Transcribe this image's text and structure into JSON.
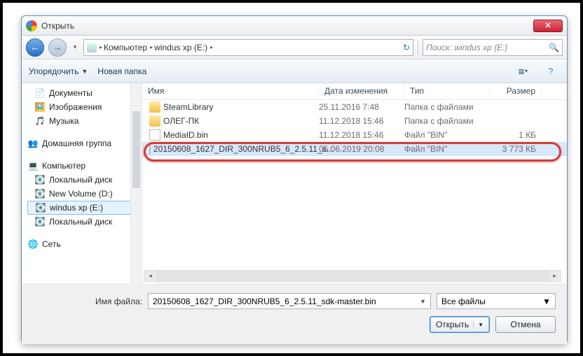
{
  "window": {
    "title": "Открыть",
    "close": "✕"
  },
  "nav": {
    "breadcrumb": [
      "Компьютер",
      "windus xp (E:)"
    ],
    "search_placeholder": "Поиск: windus xp (E:)"
  },
  "toolbar": {
    "organize": "Упорядочить",
    "new_folder": "Новая папка"
  },
  "tree": {
    "group1": [
      {
        "label": "Документы",
        "icon": "📄"
      },
      {
        "label": "Изображения",
        "icon": "🖼️"
      },
      {
        "label": "Музыка",
        "icon": "🎵"
      }
    ],
    "group2_head": "Домашняя группа",
    "group3_head": "Компьютер",
    "group3": [
      {
        "label": "Локальный диск"
      },
      {
        "label": "New Volume (D:)"
      },
      {
        "label": "windus xp (E:)"
      },
      {
        "label": "Локальный диск"
      }
    ],
    "group4_head": "Сеть"
  },
  "columns": {
    "name": "Имя",
    "date": "Дата изменения",
    "type": "Тип",
    "size": "Размер"
  },
  "rows": [
    {
      "name": "SteamLibrary",
      "date": "25.11.2016 7:48",
      "type": "Папка с файлами",
      "size": "",
      "kind": "folder"
    },
    {
      "name": "ОЛЕГ-ПК",
      "date": "11.12.2018 15:46",
      "type": "Папка с файлами",
      "size": "",
      "kind": "folder"
    },
    {
      "name": "MediaID.bin",
      "date": "11.12.2018 15:46",
      "type": "Файл \"BIN\"",
      "size": "1 КБ",
      "kind": "file"
    },
    {
      "name": "20150608_1627_DIR_300NRUB5_6_2.5.11_s...",
      "date": "05.06.2019 20:08",
      "type": "Файл \"BIN\"",
      "size": "3 773 КБ",
      "kind": "file",
      "selected": true
    }
  ],
  "filename": {
    "label": "Имя файла:",
    "value": "20150608_1627_DIR_300NRUB5_6_2.5.11_sdk-master.bin",
    "filter": "Все файлы"
  },
  "buttons": {
    "open": "Открыть",
    "cancel": "Отмена"
  }
}
